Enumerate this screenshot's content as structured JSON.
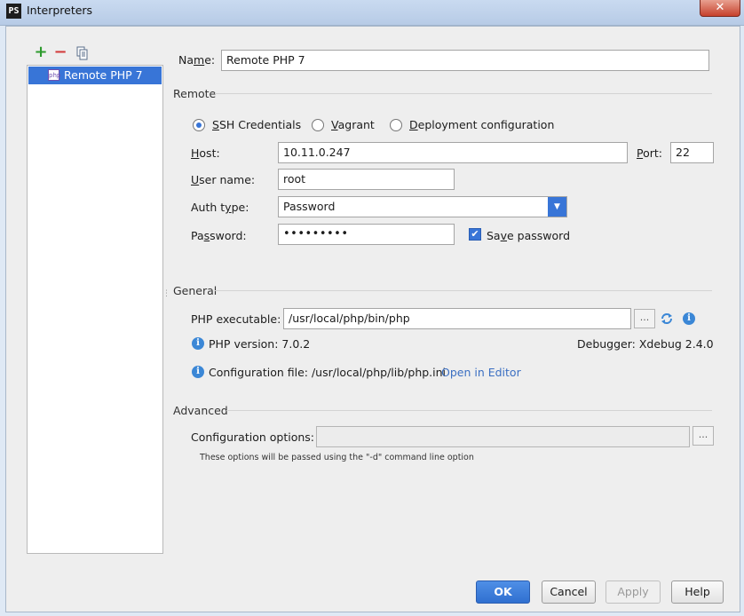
{
  "window": {
    "app_logo_text": "PS",
    "title": "Interpreters",
    "close_glyph": "✕"
  },
  "toolbar": {
    "add_icon": "plus-icon",
    "remove_icon": "minus-icon",
    "copy_icon": "copy-icon",
    "add_glyph": "+",
    "remove_glyph": "−"
  },
  "interpreters": [
    {
      "label": "Remote PHP 7",
      "selected": true
    }
  ],
  "form": {
    "name_label": "Name:",
    "name_value": "Remote PHP 7",
    "remote": {
      "section_title": "Remote",
      "options": [
        "SSH Credentials",
        "Vagrant",
        "Deployment configuration"
      ],
      "selected_option": "SSH Credentials",
      "host_label": "Host:",
      "host_value": "10.11.0.247",
      "port_label": "Port:",
      "port_value": "22",
      "username_label": "User name:",
      "username_value": "root",
      "auth_type_label": "Auth type:",
      "auth_type_value": "Password",
      "password_label": "Password:",
      "password_value": "•••••••••",
      "save_password_label": "Save password",
      "save_password_checked": true
    },
    "general": {
      "section_title": "General",
      "php_executable_label": "PHP executable:",
      "php_executable_value": "/usr/local/php/bin/php",
      "browse_glyph": "...",
      "php_version": "PHP version: 7.0.2",
      "debugger": "Debugger: Xdebug 2.4.0",
      "config_file": "Configuration file: /usr/local/php/lib/php.ini",
      "open_in_editor": "Open in Editor"
    },
    "advanced": {
      "section_title": "Advanced",
      "config_options_label": "Configuration options:",
      "config_options_value": "",
      "browse_glyph": "...",
      "hint": "These options will be passed using the \"-d\" command line option"
    }
  },
  "buttons": {
    "ok": "OK",
    "cancel": "Cancel",
    "apply": "Apply",
    "help": "Help"
  },
  "colors": {
    "accent": "#3875d7",
    "link": "#3b6fc2",
    "info": "#3b87d6",
    "add": "#2e9b2e",
    "remove": "#d23c3c"
  }
}
